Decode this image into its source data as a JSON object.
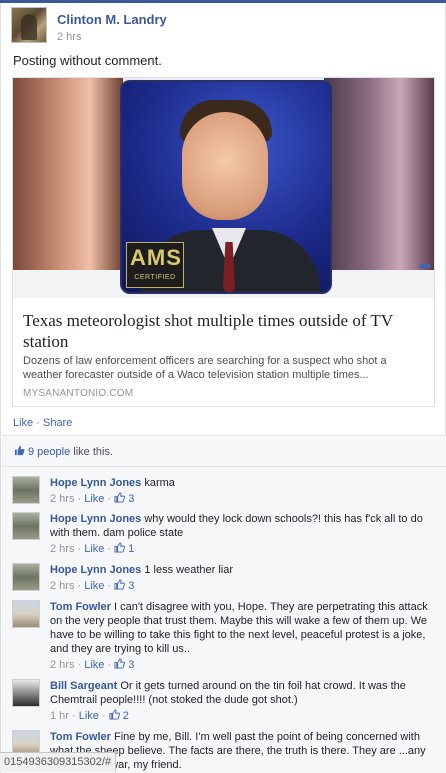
{
  "post": {
    "author": "Clinton M. Landry",
    "time": "2 hrs",
    "text": "Posting without comment."
  },
  "share": {
    "image_badge": "AMS",
    "image_badge_sub": "CERTIFIED",
    "title": "Texas meteorologist shot multiple times outside of TV station",
    "description": "Dozens of law enforcement officers are searching for a suspect who shot a weather forecaster outside of a Waco television station multiple times...",
    "source": "MYSANANTONIO.COM"
  },
  "actions": {
    "like": "Like",
    "separator": "·",
    "share": "Share"
  },
  "likes": {
    "people": "9 people",
    "suffix": " like this."
  },
  "comments": [
    {
      "name": "Hope Lynn Jones",
      "text": "karma",
      "time": "2 hrs",
      "like": "Like",
      "count": "3"
    },
    {
      "name": "Hope Lynn Jones",
      "text": "why would they lock down schools?! this has f'ck all to do with them. dam police state",
      "time": "2 hrs",
      "like": "Like",
      "count": "1"
    },
    {
      "name": "Hope Lynn Jones",
      "text": "1 less weather liar",
      "time": "2 hrs",
      "like": "Like",
      "count": "3"
    },
    {
      "name": "Tom Fowler",
      "text": "I can't disagree with you, Hope. They are perpetrating this attack on the very people that trust them. Maybe this will wake a few of them up. We have to be willing to take this fight to the next level, peaceful protest is a joke, and they are trying to kill us..",
      "time": "2 hrs",
      "like": "Like",
      "count": "3"
    },
    {
      "name": "Bill Sargeant",
      "text": "Or it gets turned around on the tin foil hat crowd. It was the Chemtrail people!!!! (not stoked the dude got shot.)",
      "time": "1 hr",
      "like": "Like",
      "count": "2"
    },
    {
      "name": "Tom Fowler",
      "text": "Fine by me, Bill. I'm well past the point of being concerned with what the sheep believe. The facts are there, the truth is there. They are ...any ways, that's war, my friend.",
      "time": "",
      "like": "",
      "count": ""
    }
  ],
  "status_url": "015493630931530​2/#",
  "colors": {
    "link": "#365899",
    "brand": "#3b5998",
    "meta": "#90949c"
  }
}
